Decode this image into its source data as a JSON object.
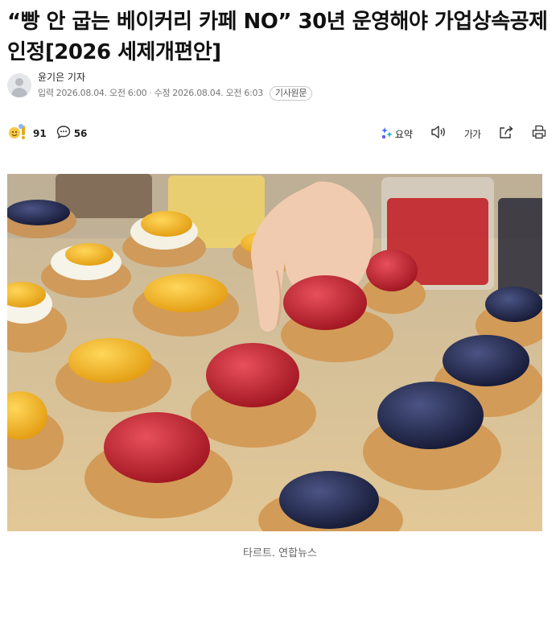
{
  "article": {
    "headline": "“빵 안 굽는 베이커리 카페 NO” 30년 운영해야 가업상속공제 인정[2026 세제개편안]",
    "reporter": "윤기은 기자",
    "published_label": "입력",
    "published_at": "2026.08.04. 오전 6:00",
    "updated_label": "수정",
    "updated_at": "2026.08.04. 오전 6:03",
    "original_button": "기사원문"
  },
  "reactions": {
    "emoji_count": "91",
    "comment_count": "56"
  },
  "tools": {
    "summary_label": "요약",
    "font_label": "가가"
  },
  "photo": {
    "caption": "타르트. 연합뉴스",
    "subject": "fruit tarts with strawberries, blueberries and mango on a wooden table"
  },
  "colors": {
    "summary_accent": "#3b6cf6",
    "strawberry": "#c8242c",
    "blueberry": "#1f2446",
    "mango": "#f2b51e",
    "pastry": "#d39b58"
  }
}
